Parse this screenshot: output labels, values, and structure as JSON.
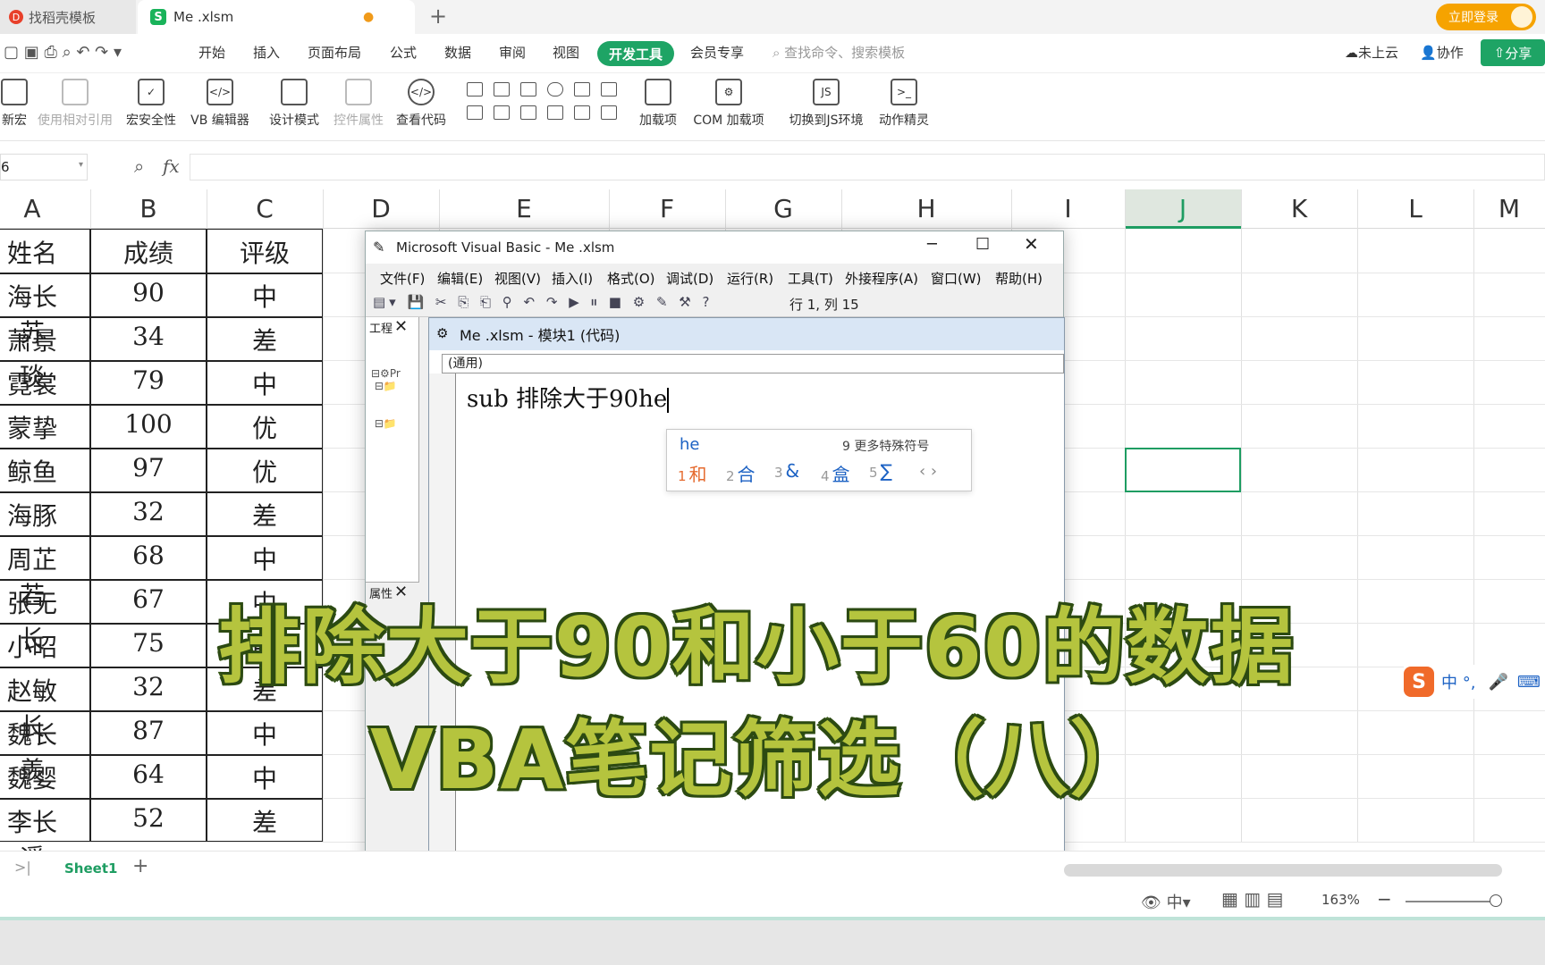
{
  "tabs": {
    "tab1": "找稻壳模板",
    "tab2": "Me .xlsm",
    "login": "立即登录"
  },
  "menu": {
    "items": [
      "开始",
      "插入",
      "页面布局",
      "公式",
      "数据",
      "审阅",
      "视图"
    ],
    "active": "开发工具",
    "vip": "会员专享",
    "search": "查找命令、搜索模板",
    "cloud": "未上云",
    "collab": "协作",
    "share": "分享"
  },
  "ribbon": [
    {
      "label": "新宏",
      "dim": false
    },
    {
      "label": "使用相对引用",
      "dim": true
    },
    {
      "label": "宏安全性",
      "dim": false
    },
    {
      "label": "VB 编辑器",
      "dim": false
    },
    {
      "label": "设计模式",
      "dim": false
    },
    {
      "label": "控件属性",
      "dim": true
    },
    {
      "label": "查看代码",
      "dim": false
    },
    {
      "label": "加载项",
      "dim": false
    },
    {
      "label": "COM 加载项",
      "dim": false
    },
    {
      "label": "切换到JS环境",
      "dim": false
    },
    {
      "label": "动作精灵",
      "dim": false
    }
  ],
  "formula": {
    "namebox": "6",
    "fx": "fx"
  },
  "columns": [
    "A",
    "B",
    "C",
    "D",
    "E",
    "F",
    "G",
    "H",
    "I",
    "J",
    "K",
    "L",
    "M"
  ],
  "table": {
    "headers": [
      "姓名",
      "成绩",
      "评级"
    ],
    "rows": [
      [
        "海长苏",
        "90",
        "中"
      ],
      [
        "萧景琰",
        "34",
        "差"
      ],
      [
        "霓裳",
        "79",
        "中"
      ],
      [
        "蒙挚",
        "100",
        "优"
      ],
      [
        "鲸鱼",
        "97",
        "优"
      ],
      [
        "海豚",
        "32",
        "差"
      ],
      [
        "周芷若",
        "68",
        "中"
      ],
      [
        "张无长",
        "67",
        "中"
      ],
      [
        "小昭",
        "75",
        "中"
      ],
      [
        "赵敏长",
        "32",
        "差"
      ],
      [
        "魏长羡",
        "87",
        "中"
      ],
      [
        "魏婴",
        "64",
        "中"
      ],
      [
        "李长遥",
        "52",
        "差"
      ]
    ]
  },
  "sheet": {
    "tab": "Sheet1",
    "zoom": "163%"
  },
  "vba": {
    "title": "Microsoft Visual Basic - Me .xlsm",
    "menu": [
      "文件(F)",
      "编辑(E)",
      "视图(V)",
      "插入(I)",
      "格式(O)",
      "调试(D)",
      "运行(R)",
      "工具(T)",
      "外接程序(A)",
      "窗口(W)",
      "帮助(H)"
    ],
    "position": "行 1, 列 15",
    "project_pane": "工程",
    "props_pane": "属性",
    "code_title": "Me .xlsm - 模块1 (代码)",
    "combo": "(通用)",
    "code": "sub 排除大于90he"
  },
  "ime": {
    "typed": "he",
    "more": "9 更多特殊符号",
    "candidates": [
      {
        "n": "1",
        "c": "和"
      },
      {
        "n": "2",
        "c": "合"
      },
      {
        "n": "3",
        "c": "&"
      },
      {
        "n": "4",
        "c": "盒"
      },
      {
        "n": "5",
        "c": "∑"
      }
    ],
    "bar": "中 °,"
  },
  "overlay": {
    "line1": "排除大于90和小于60的数据",
    "line2": "VBA笔记筛选（八）"
  }
}
